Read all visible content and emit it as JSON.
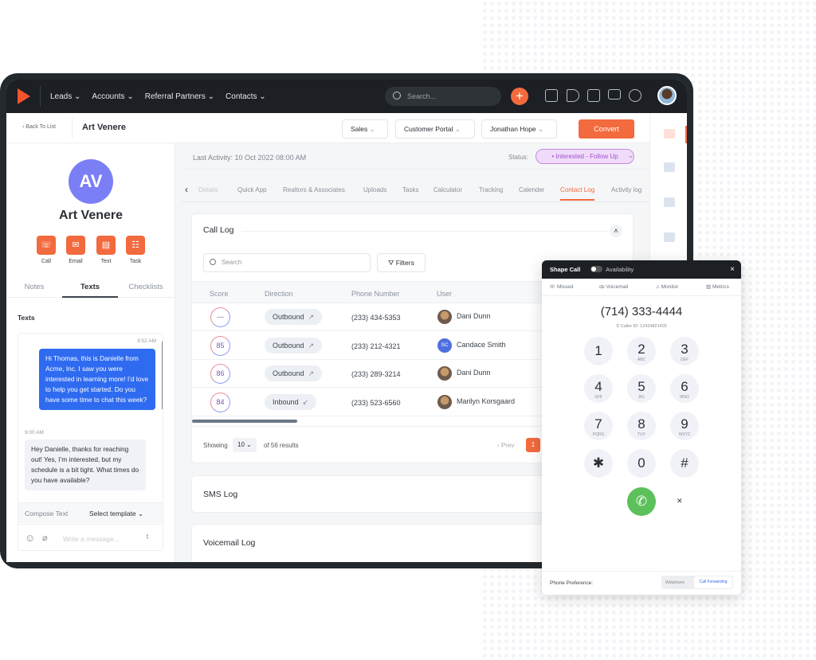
{
  "nav": {
    "items": [
      "Leads",
      "Accounts",
      "Referral Partners",
      "Contacts"
    ],
    "search_placeholder": "Search..."
  },
  "header": {
    "back": "Back To List",
    "name": "Art Venere",
    "dropdowns": [
      "Sales",
      "Customer Portal",
      "Jonathan Hope"
    ],
    "convert": "Convert"
  },
  "profile": {
    "initials": "AV",
    "name": "Art Venere",
    "actions": [
      "Call",
      "Email",
      "Text",
      "Task"
    ],
    "tabs": [
      "Notes",
      "Texts",
      "Checklists"
    ],
    "active_tab": "Texts",
    "section": "Texts"
  },
  "messages": [
    {
      "time": "9:52 AM",
      "text": "Hi Thomas, this is Danielle from Acme, Inc. I saw you were interested in learning more! I’d love to help you get started. Do you have some time to chat this week?"
    },
    {
      "time": "9:00 AM",
      "text": "Hey Danielle, thanks for reaching out! Yes, I’m interested, but my schedule is a bit tight. What times do you have available?"
    }
  ],
  "compose": {
    "label": "Compose Text",
    "template": "Select template",
    "placeholder": "Write a message..."
  },
  "main": {
    "last_activity": "Last Activity: 10 Oct 2022 08:00 AM",
    "status_label": "Status:",
    "status": "• Interested - Follow Up",
    "tabs": [
      "Details",
      "Quick App",
      "Realtors & Associates",
      "Uploads",
      "Tasks",
      "Calculator",
      "Tracking",
      "Calender",
      "Contact Log",
      "Activity log"
    ],
    "active_tab": "Contact Log"
  },
  "call_log": {
    "title": "Call Log",
    "search_placeholder": "Search",
    "filters": "Filters",
    "columns": [
      "Score",
      "Direction",
      "Phone Number",
      "User"
    ],
    "rows": [
      {
        "score": "---",
        "direction": "Outbound",
        "arrow": "↗",
        "phone": "(233) 434-5353",
        "user": "Dani Dunn",
        "initials": ""
      },
      {
        "score": "85",
        "direction": "Outbound",
        "arrow": "↗",
        "phone": "(233) 212-4321",
        "user": "Candace Smith",
        "initials": "SC"
      },
      {
        "score": "86",
        "direction": "Outbound",
        "arrow": "↗",
        "phone": "(233) 289-3214",
        "user": "Dani Dunn",
        "initials": ""
      },
      {
        "score": "84",
        "direction": "Inbound",
        "arrow": "↙",
        "phone": "(233) 523-6560",
        "user": "Marilyn Korsgaard",
        "initials": ""
      }
    ],
    "showing": "Showing",
    "page_size": "10",
    "results": "of 56 results",
    "prev": "‹ Prev",
    "page": "1"
  },
  "sms_log": "SMS Log",
  "voicemail_log": "Voicemail Log",
  "dialer": {
    "title": "Shape Call",
    "availability": "Availability",
    "availability_on": false,
    "tabs": [
      "Missed",
      "Voicemail",
      "Monitor",
      "Metrics"
    ],
    "number": "(714) 333-4444",
    "caller_id": "Caller ID: 12424821425",
    "keys": [
      [
        "1",
        ""
      ],
      [
        "2",
        "ABC"
      ],
      [
        "3",
        "DEF"
      ],
      [
        "4",
        "GHI"
      ],
      [
        "5",
        "JKL"
      ],
      [
        "6",
        "MNO"
      ],
      [
        "7",
        "PQRS"
      ],
      [
        "8",
        "TUV"
      ],
      [
        "9",
        "WXYZ"
      ],
      [
        "✱",
        ""
      ],
      [
        "0",
        ""
      ],
      [
        "#",
        ""
      ]
    ],
    "pref_label": "Phone Preference:",
    "pref_options": [
      "Webphone",
      "Call Forwarding"
    ],
    "pref_selected": "Call Forwarding"
  },
  "colors": {
    "accent": "#f26a3d",
    "nav": "#1c1f23",
    "status": "#a24fcf",
    "call": "#5cc15a",
    "bubble": "#2f6bf0"
  }
}
